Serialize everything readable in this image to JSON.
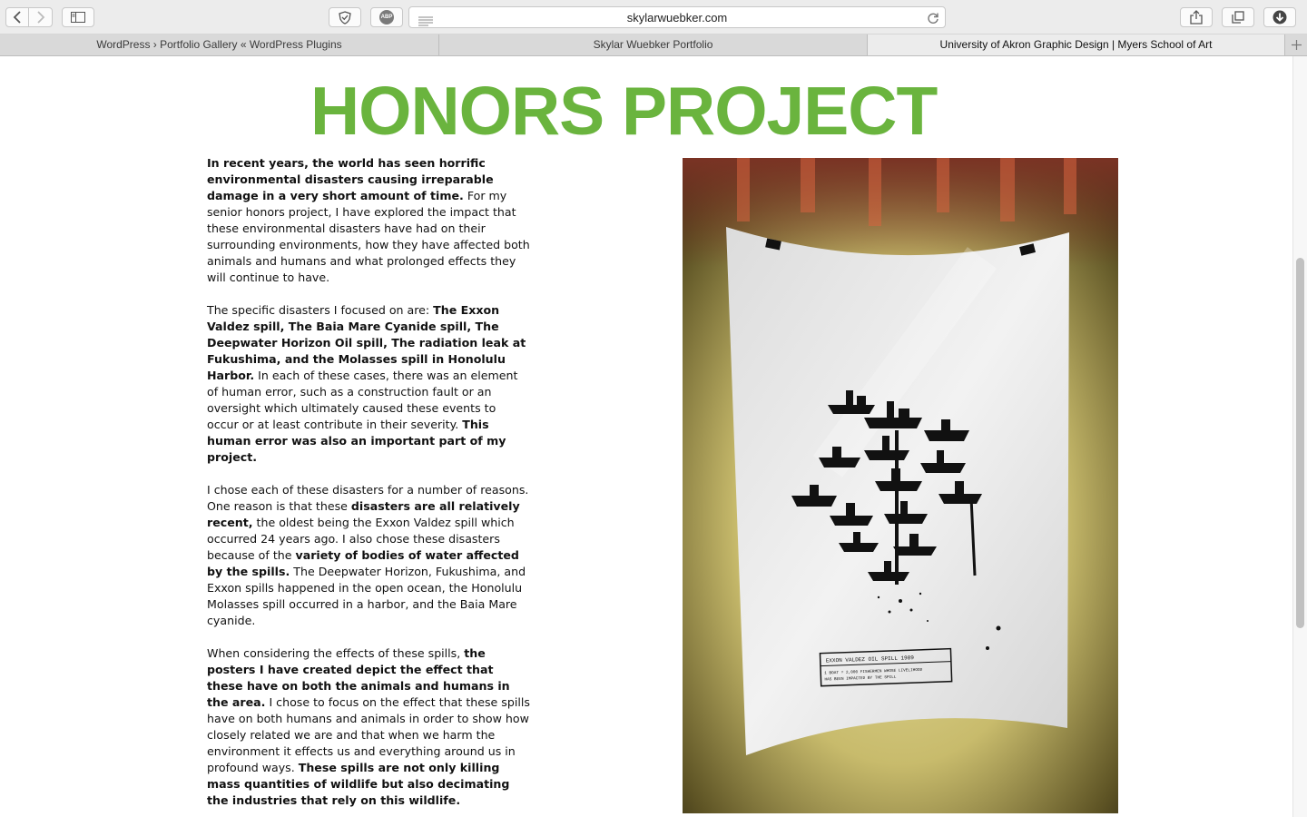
{
  "browser": {
    "url": "skylarwuebker.com",
    "icons": [
      "back-icon",
      "forward-icon",
      "sidebar-icon",
      "shield-icon",
      "adblock-icon",
      "reader-icon",
      "reload-icon",
      "share-icon",
      "tabs-icon",
      "download-icon",
      "new-tab-icon"
    ],
    "adblock_label": "ABP"
  },
  "tabs": [
    {
      "label": "WordPress › Portfolio Gallery « WordPress Plugins"
    },
    {
      "label": "Skylar Wuebker Portfolio"
    },
    {
      "label": "University of Akron Graphic Design | Myers School of Art"
    }
  ],
  "page": {
    "title": "HONORS PROJECT",
    "accent_color": "#6ab43e",
    "paragraphs": [
      [
        {
          "t": "In recent years, the world has seen horrific environmental disasters causing irreparable damage in a very short amount of time.",
          "b": true
        },
        {
          "t": " For my senior honors project, I have explored the impact that these environmental disasters have had on their surrounding environments, how they have affected both animals and humans and what prolonged effects they will continue to have.",
          "b": false
        }
      ],
      [
        {
          "t": "The specific disasters I focused on are: ",
          "b": false
        },
        {
          "t": "The Exxon Valdez spill, The Baia Mare Cyanide spill, The Deepwater Horizon Oil spill, The radiation leak at Fukushima, and the Molasses spill in Honolulu Harbor.",
          "b": true
        },
        {
          "t": " In each of these cases, there was an element of human error, such as a construction fault or an oversight which ultimately caused these events to occur or at least contribute in their severity. ",
          "b": false
        },
        {
          "t": "This human error was also an important part of my project.",
          "b": true
        }
      ],
      [
        {
          "t": "I chose each of these disasters for a number of reasons. One reason is that these ",
          "b": false
        },
        {
          "t": "disasters are all relatively recent,",
          "b": true
        },
        {
          "t": " the oldest being the Exxon Valdez spill which occurred 24 years ago. I also chose these disasters because of the ",
          "b": false
        },
        {
          "t": "variety of bodies of water affected by the spills.",
          "b": true
        },
        {
          "t": " The Deepwater Horizon, Fukushima, and Exxon spills happened in the open ocean, the Honolulu Molasses spill occurred in a harbor, and the Baia Mare cyanide.",
          "b": false
        }
      ],
      [
        {
          "t": "When considering the effects of these spills, ",
          "b": false
        },
        {
          "t": "the posters I have created depict the effect that these have on both the animals and humans in the area.",
          "b": true
        },
        {
          "t": " I chose to focus on the effect that these spills have on both humans and animals in order to show how closely related we are and that when we harm the environment it effects us and everything around us in profound ways. ",
          "b": false
        },
        {
          "t": "These spills are not only killing mass quantities of wildlife but also decimating the industries that rely on this wildlife.",
          "b": true
        }
      ]
    ],
    "poster": {
      "caption_line1": "EXXON VALDEZ OIL SPILL 1989",
      "caption_line2": "1 BOAT = 2,000 FISHERMEN WHOSE LIVELIHOOD",
      "caption_line3": "HAS BEEN IMPACTED BY THE SPILL"
    }
  }
}
